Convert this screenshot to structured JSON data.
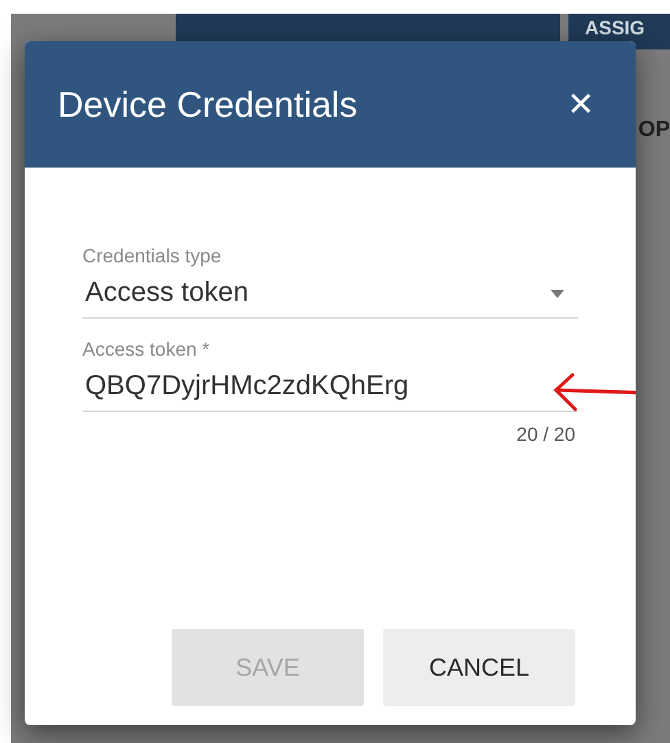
{
  "background": {
    "button": "ASSIG",
    "tab": "OP"
  },
  "dialog": {
    "title": "Device Credentials",
    "close": "✕",
    "fields": [
      {
        "kind": "select",
        "label": "Credentials type",
        "value": "Access token"
      },
      {
        "kind": "text",
        "label": "Access token *",
        "value": "QBQ7DyjrHMc2zdKQhErg",
        "counter": "20 / 20"
      }
    ],
    "buttons": [
      {
        "label": "SAVE",
        "disabled": true
      },
      {
        "label": "CANCEL",
        "disabled": false
      }
    ]
  }
}
